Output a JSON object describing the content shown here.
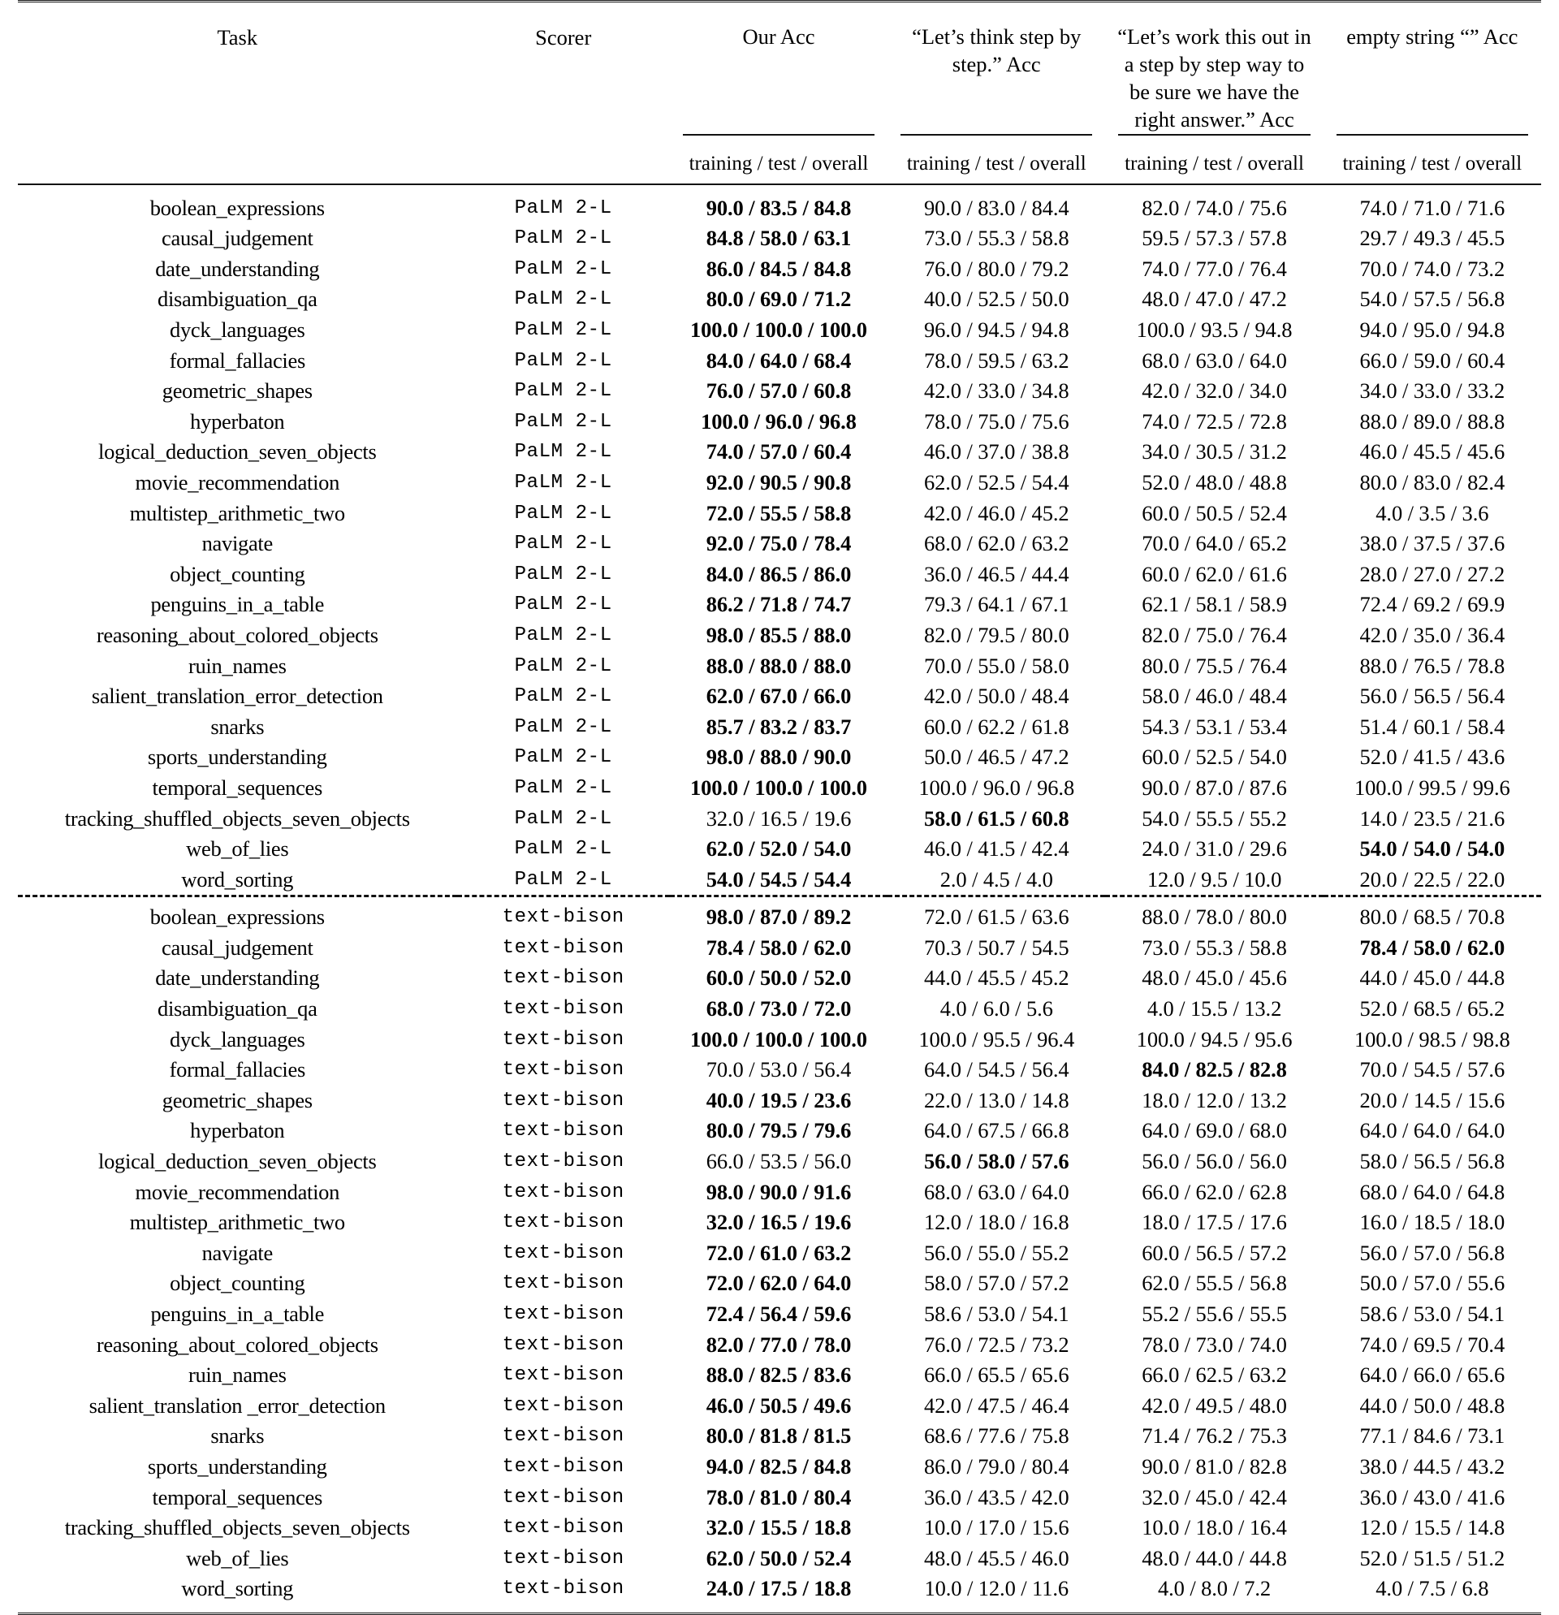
{
  "table": {
    "columns": [
      {
        "key": "task",
        "label": "Task"
      },
      {
        "key": "scorer",
        "label": "Scorer"
      },
      {
        "key": "ours",
        "label": "Our Acc"
      },
      {
        "key": "lets_think",
        "label": "“Let’s think step by step.” Acc"
      },
      {
        "key": "lets_work",
        "label": "“Let’s work this out in a step by step way to be sure we have the right answer.” Acc"
      },
      {
        "key": "empty",
        "label": "empty string “” Acc"
      }
    ],
    "header_lines": {
      "task": [
        "Task"
      ],
      "scorer": [
        "Scorer"
      ],
      "ours": [
        "Our Acc"
      ],
      "lets_think": [
        "“Let’s think step by",
        "step.” Acc"
      ],
      "lets_work": [
        "“Let’s work this out in",
        "a step by step way to",
        "be sure we have the",
        "right answer.” Acc"
      ],
      "empty": [
        "empty string “” Acc"
      ]
    },
    "subheader": "training / test / overall",
    "scorers": {
      "palm": "PaLM 2-L",
      "bison": "text-bison"
    },
    "blocks": [
      {
        "scorer": "PaLM 2-L",
        "rows": [
          {
            "task": "boolean_expressions",
            "ours": "90.0 / 83.5 / 84.8",
            "ours_bold": true,
            "lets_think": "90.0 / 83.0 / 84.4",
            "lets_think_bold": false,
            "lets_work": "82.0 / 74.0 / 75.6",
            "lets_work_bold": false,
            "empty": "74.0 / 71.0 / 71.6",
            "empty_bold": false
          },
          {
            "task": "causal_judgement",
            "ours": "84.8 / 58.0 / 63.1",
            "ours_bold": true,
            "lets_think": "73.0 / 55.3 / 58.8",
            "lets_think_bold": false,
            "lets_work": "59.5 / 57.3 / 57.8",
            "lets_work_bold": false,
            "empty": "29.7 / 49.3 / 45.5",
            "empty_bold": false
          },
          {
            "task": "date_understanding",
            "ours": "86.0 / 84.5 / 84.8",
            "ours_bold": true,
            "lets_think": "76.0 / 80.0 / 79.2",
            "lets_think_bold": false,
            "lets_work": "74.0 / 77.0 / 76.4",
            "lets_work_bold": false,
            "empty": "70.0 / 74.0 / 73.2",
            "empty_bold": false
          },
          {
            "task": "disambiguation_qa",
            "ours": "80.0 / 69.0 / 71.2",
            "ours_bold": true,
            "lets_think": "40.0 / 52.5 / 50.0",
            "lets_think_bold": false,
            "lets_work": "48.0 / 47.0 / 47.2",
            "lets_work_bold": false,
            "empty": "54.0 / 57.5 / 56.8",
            "empty_bold": false
          },
          {
            "task": "dyck_languages",
            "ours": "100.0 / 100.0 / 100.0",
            "ours_bold": true,
            "lets_think": "96.0 / 94.5 / 94.8",
            "lets_think_bold": false,
            "lets_work": "100.0 / 93.5 / 94.8",
            "lets_work_bold": false,
            "empty": "94.0 / 95.0 / 94.8",
            "empty_bold": false
          },
          {
            "task": "formal_fallacies",
            "ours": "84.0 / 64.0 / 68.4",
            "ours_bold": true,
            "lets_think": "78.0 / 59.5 / 63.2",
            "lets_think_bold": false,
            "lets_work": "68.0 / 63.0 / 64.0",
            "lets_work_bold": false,
            "empty": "66.0 / 59.0 / 60.4",
            "empty_bold": false
          },
          {
            "task": "geometric_shapes",
            "ours": "76.0 / 57.0 / 60.8",
            "ours_bold": true,
            "lets_think": "42.0 / 33.0 / 34.8",
            "lets_think_bold": false,
            "lets_work": "42.0 / 32.0 / 34.0",
            "lets_work_bold": false,
            "empty": "34.0 / 33.0 / 33.2",
            "empty_bold": false
          },
          {
            "task": "hyperbaton",
            "ours": "100.0 / 96.0 / 96.8",
            "ours_bold": true,
            "lets_think": "78.0 / 75.0 / 75.6",
            "lets_think_bold": false,
            "lets_work": "74.0 / 72.5 / 72.8",
            "lets_work_bold": false,
            "empty": "88.0 / 89.0 / 88.8",
            "empty_bold": false
          },
          {
            "task": "logical_deduction_seven_objects",
            "ours": "74.0 / 57.0 / 60.4",
            "ours_bold": true,
            "lets_think": "46.0 / 37.0 / 38.8",
            "lets_think_bold": false,
            "lets_work": "34.0 / 30.5 / 31.2",
            "lets_work_bold": false,
            "empty": "46.0 / 45.5 / 45.6",
            "empty_bold": false
          },
          {
            "task": "movie_recommendation",
            "ours": "92.0 / 90.5 / 90.8",
            "ours_bold": true,
            "lets_think": "62.0 / 52.5 / 54.4",
            "lets_think_bold": false,
            "lets_work": "52.0 / 48.0 / 48.8",
            "lets_work_bold": false,
            "empty": "80.0 / 83.0 / 82.4",
            "empty_bold": false
          },
          {
            "task": "multistep_arithmetic_two",
            "ours": "72.0 / 55.5 / 58.8",
            "ours_bold": true,
            "lets_think": "42.0 / 46.0 / 45.2",
            "lets_think_bold": false,
            "lets_work": "60.0 / 50.5 / 52.4",
            "lets_work_bold": false,
            "empty": "4.0 / 3.5 / 3.6",
            "empty_bold": false
          },
          {
            "task": "navigate",
            "ours": "92.0 / 75.0 / 78.4",
            "ours_bold": true,
            "lets_think": "68.0 / 62.0 / 63.2",
            "lets_think_bold": false,
            "lets_work": "70.0 / 64.0 / 65.2",
            "lets_work_bold": false,
            "empty": "38.0 / 37.5 / 37.6",
            "empty_bold": false
          },
          {
            "task": "object_counting",
            "ours": "84.0 / 86.5 / 86.0",
            "ours_bold": true,
            "lets_think": "36.0 / 46.5 / 44.4",
            "lets_think_bold": false,
            "lets_work": "60.0 / 62.0 / 61.6",
            "lets_work_bold": false,
            "empty": "28.0 / 27.0 / 27.2",
            "empty_bold": false
          },
          {
            "task": "penguins_in_a_table",
            "ours": "86.2 / 71.8 / 74.7",
            "ours_bold": true,
            "lets_think": "79.3 / 64.1 / 67.1",
            "lets_think_bold": false,
            "lets_work": "62.1 / 58.1 / 58.9",
            "lets_work_bold": false,
            "empty": "72.4 / 69.2 / 69.9",
            "empty_bold": false
          },
          {
            "task": "reasoning_about_colored_objects",
            "ours": "98.0 / 85.5 / 88.0",
            "ours_bold": true,
            "lets_think": "82.0 / 79.5 / 80.0",
            "lets_think_bold": false,
            "lets_work": "82.0 / 75.0 / 76.4",
            "lets_work_bold": false,
            "empty": "42.0 / 35.0 / 36.4",
            "empty_bold": false
          },
          {
            "task": "ruin_names",
            "ours": "88.0 / 88.0 / 88.0",
            "ours_bold": true,
            "lets_think": "70.0 / 55.0 / 58.0",
            "lets_think_bold": false,
            "lets_work": "80.0 / 75.5 / 76.4",
            "lets_work_bold": false,
            "empty": "88.0 / 76.5 / 78.8",
            "empty_bold": false
          },
          {
            "task": "salient_translation_error_detection",
            "ours": "62.0 / 67.0 / 66.0",
            "ours_bold": true,
            "lets_think": "42.0 / 50.0 / 48.4",
            "lets_think_bold": false,
            "lets_work": "58.0 / 46.0 / 48.4",
            "lets_work_bold": false,
            "empty": "56.0 / 56.5 / 56.4",
            "empty_bold": false
          },
          {
            "task": "snarks",
            "ours": "85.7 / 83.2 / 83.7",
            "ours_bold": true,
            "lets_think": "60.0 / 62.2 / 61.8",
            "lets_think_bold": false,
            "lets_work": "54.3 / 53.1 / 53.4",
            "lets_work_bold": false,
            "empty": "51.4 / 60.1 / 58.4",
            "empty_bold": false
          },
          {
            "task": "sports_understanding",
            "ours": "98.0 / 88.0 / 90.0",
            "ours_bold": true,
            "lets_think": "50.0 / 46.5 / 47.2",
            "lets_think_bold": false,
            "lets_work": "60.0 / 52.5 / 54.0",
            "lets_work_bold": false,
            "empty": "52.0 / 41.5 / 43.6",
            "empty_bold": false
          },
          {
            "task": "temporal_sequences",
            "ours": "100.0 / 100.0 / 100.0",
            "ours_bold": true,
            "lets_think": "100.0 / 96.0 / 96.8",
            "lets_think_bold": false,
            "lets_work": "90.0 / 87.0 / 87.6",
            "lets_work_bold": false,
            "empty": "100.0 / 99.5 / 99.6",
            "empty_bold": false
          },
          {
            "task": "tracking_shuffled_objects_seven_objects",
            "ours": "32.0 / 16.5 / 19.6",
            "ours_bold": false,
            "lets_think": "58.0 / 61.5 / 60.8",
            "lets_think_bold": true,
            "lets_work": "54.0 / 55.5 / 55.2",
            "lets_work_bold": false,
            "empty": "14.0 / 23.5 / 21.6",
            "empty_bold": false
          },
          {
            "task": "web_of_lies",
            "ours": "62.0 / 52.0 / 54.0",
            "ours_bold": true,
            "lets_think": "46.0 / 41.5 / 42.4",
            "lets_think_bold": false,
            "lets_work": "24.0 / 31.0 / 29.6",
            "lets_work_bold": false,
            "empty": "54.0 / 54.0 / 54.0",
            "empty_bold": true
          },
          {
            "task": "word_sorting",
            "ours": "54.0 / 54.5 / 54.4",
            "ours_bold": true,
            "lets_think": "2.0 / 4.5 / 4.0",
            "lets_think_bold": false,
            "lets_work": "12.0 / 9.5 / 10.0",
            "lets_work_bold": false,
            "empty": "20.0 / 22.5 / 22.0",
            "empty_bold": false
          }
        ]
      },
      {
        "scorer": "text-bison",
        "rows": [
          {
            "task": "boolean_expressions",
            "ours": "98.0 / 87.0 / 89.2",
            "ours_bold": true,
            "lets_think": "72.0 / 61.5 / 63.6",
            "lets_think_bold": false,
            "lets_work": "88.0 / 78.0 / 80.0",
            "lets_work_bold": false,
            "empty": "80.0 / 68.5 / 70.8",
            "empty_bold": false
          },
          {
            "task": "causal_judgement",
            "ours": "78.4 / 58.0 / 62.0",
            "ours_bold": true,
            "lets_think": "70.3 / 50.7 / 54.5",
            "lets_think_bold": false,
            "lets_work": "73.0 / 55.3 / 58.8",
            "lets_work_bold": false,
            "empty": "78.4 / 58.0 / 62.0",
            "empty_bold": true
          },
          {
            "task": "date_understanding",
            "ours": "60.0 / 50.0 / 52.0",
            "ours_bold": true,
            "lets_think": "44.0 / 45.5 / 45.2",
            "lets_think_bold": false,
            "lets_work": "48.0 / 45.0 / 45.6",
            "lets_work_bold": false,
            "empty": "44.0 / 45.0 / 44.8",
            "empty_bold": false
          },
          {
            "task": "disambiguation_qa",
            "ours": "68.0 / 73.0 / 72.0",
            "ours_bold": true,
            "lets_think": "4.0 / 6.0 / 5.6",
            "lets_think_bold": false,
            "lets_work": "4.0 / 15.5 / 13.2",
            "lets_work_bold": false,
            "empty": "52.0 / 68.5 / 65.2",
            "empty_bold": false
          },
          {
            "task": "dyck_languages",
            "ours": "100.0 / 100.0 / 100.0",
            "ours_bold": true,
            "lets_think": "100.0 / 95.5 / 96.4",
            "lets_think_bold": false,
            "lets_work": "100.0 / 94.5 / 95.6",
            "lets_work_bold": false,
            "empty": "100.0 / 98.5 / 98.8",
            "empty_bold": false
          },
          {
            "task": "formal_fallacies",
            "ours": "70.0 / 53.0 / 56.4",
            "ours_bold": false,
            "lets_think": "64.0 / 54.5 / 56.4",
            "lets_think_bold": false,
            "lets_work": "84.0 / 82.5 / 82.8",
            "lets_work_bold": true,
            "empty": "70.0 / 54.5 / 57.6",
            "empty_bold": false
          },
          {
            "task": "geometric_shapes",
            "ours": "40.0 / 19.5 / 23.6",
            "ours_bold": true,
            "lets_think": "22.0 / 13.0 / 14.8",
            "lets_think_bold": false,
            "lets_work": "18.0 / 12.0 / 13.2",
            "lets_work_bold": false,
            "empty": "20.0 / 14.5 / 15.6",
            "empty_bold": false
          },
          {
            "task": "hyperbaton",
            "ours": "80.0 / 79.5 / 79.6",
            "ours_bold": true,
            "lets_think": "64.0 / 67.5 / 66.8",
            "lets_think_bold": false,
            "lets_work": "64.0 / 69.0 / 68.0",
            "lets_work_bold": false,
            "empty": "64.0 / 64.0 / 64.0",
            "empty_bold": false
          },
          {
            "task": "logical_deduction_seven_objects",
            "ours": "66.0 / 53.5 / 56.0",
            "ours_bold": false,
            "lets_think": "56.0 / 58.0 / 57.6",
            "lets_think_bold": true,
            "lets_work": "56.0 / 56.0 / 56.0",
            "lets_work_bold": false,
            "empty": "58.0 / 56.5 / 56.8",
            "empty_bold": false
          },
          {
            "task": "movie_recommendation",
            "ours": "98.0 / 90.0 / 91.6",
            "ours_bold": true,
            "lets_think": "68.0 / 63.0 / 64.0",
            "lets_think_bold": false,
            "lets_work": "66.0 / 62.0 / 62.8",
            "lets_work_bold": false,
            "empty": "68.0 / 64.0 / 64.8",
            "empty_bold": false
          },
          {
            "task": "multistep_arithmetic_two",
            "ours": "32.0 / 16.5 / 19.6",
            "ours_bold": true,
            "lets_think": "12.0 / 18.0 / 16.8",
            "lets_think_bold": false,
            "lets_work": "18.0 / 17.5 / 17.6",
            "lets_work_bold": false,
            "empty": "16.0 / 18.5 / 18.0",
            "empty_bold": false
          },
          {
            "task": "navigate",
            "ours": "72.0 / 61.0 / 63.2",
            "ours_bold": true,
            "lets_think": "56.0 / 55.0 / 55.2",
            "lets_think_bold": false,
            "lets_work": "60.0 / 56.5 / 57.2",
            "lets_work_bold": false,
            "empty": "56.0 / 57.0 / 56.8",
            "empty_bold": false
          },
          {
            "task": "object_counting",
            "ours": "72.0 / 62.0 / 64.0",
            "ours_bold": true,
            "lets_think": "58.0 / 57.0 / 57.2",
            "lets_think_bold": false,
            "lets_work": "62.0 / 55.5 / 56.8",
            "lets_work_bold": false,
            "empty": "50.0 / 57.0 / 55.6",
            "empty_bold": false
          },
          {
            "task": "penguins_in_a_table",
            "ours": "72.4 / 56.4 / 59.6",
            "ours_bold": true,
            "lets_think": "58.6 / 53.0 / 54.1",
            "lets_think_bold": false,
            "lets_work": "55.2 / 55.6 / 55.5",
            "lets_work_bold": false,
            "empty": "58.6 / 53.0 / 54.1",
            "empty_bold": false
          },
          {
            "task": "reasoning_about_colored_objects",
            "ours": "82.0 / 77.0 / 78.0",
            "ours_bold": true,
            "lets_think": "76.0 / 72.5 / 73.2",
            "lets_think_bold": false,
            "lets_work": "78.0 / 73.0 / 74.0",
            "lets_work_bold": false,
            "empty": "74.0 / 69.5 / 70.4",
            "empty_bold": false
          },
          {
            "task": "ruin_names",
            "ours": "88.0 / 82.5 / 83.6",
            "ours_bold": true,
            "lets_think": "66.0 / 65.5 / 65.6",
            "lets_think_bold": false,
            "lets_work": "66.0 / 62.5 / 63.2",
            "lets_work_bold": false,
            "empty": "64.0 / 66.0 / 65.6",
            "empty_bold": false
          },
          {
            "task": "salient_translation _error_detection",
            "ours": "46.0 / 50.5 / 49.6",
            "ours_bold": true,
            "lets_think": "42.0 / 47.5 / 46.4",
            "lets_think_bold": false,
            "lets_work": "42.0 / 49.5 / 48.0",
            "lets_work_bold": false,
            "empty": "44.0 / 50.0 / 48.8",
            "empty_bold": false
          },
          {
            "task": "snarks",
            "ours": "80.0 / 81.8 / 81.5",
            "ours_bold": true,
            "lets_think": "68.6 / 77.6 / 75.8",
            "lets_think_bold": false,
            "lets_work": "71.4 / 76.2 / 75.3",
            "lets_work_bold": false,
            "empty": "77.1 / 84.6 / 73.1",
            "empty_bold": false
          },
          {
            "task": "sports_understanding",
            "ours": "94.0 / 82.5 / 84.8",
            "ours_bold": true,
            "lets_think": "86.0 / 79.0 / 80.4",
            "lets_think_bold": false,
            "lets_work": "90.0 / 81.0 / 82.8",
            "lets_work_bold": false,
            "empty": "38.0 / 44.5 / 43.2",
            "empty_bold": false
          },
          {
            "task": "temporal_sequences",
            "ours": "78.0 / 81.0 / 80.4",
            "ours_bold": true,
            "lets_think": "36.0 / 43.5 / 42.0",
            "lets_think_bold": false,
            "lets_work": "32.0 / 45.0 / 42.4",
            "lets_work_bold": false,
            "empty": "36.0 / 43.0 / 41.6",
            "empty_bold": false
          },
          {
            "task": "tracking_shuffled_objects_seven_objects",
            "ours": "32.0 / 15.5 / 18.8",
            "ours_bold": true,
            "lets_think": "10.0 / 17.0 / 15.6",
            "lets_think_bold": false,
            "lets_work": "10.0 / 18.0 / 16.4",
            "lets_work_bold": false,
            "empty": "12.0 / 15.5 / 14.8",
            "empty_bold": false
          },
          {
            "task": "web_of_lies",
            "ours": "62.0 / 50.0 / 52.4",
            "ours_bold": true,
            "lets_think": "48.0 / 45.5 / 46.0",
            "lets_think_bold": false,
            "lets_work": "48.0 / 44.0 / 44.8",
            "lets_work_bold": false,
            "empty": "52.0 / 51.5 / 51.2",
            "empty_bold": false
          },
          {
            "task": "word_sorting",
            "ours": "24.0 / 17.5 / 18.8",
            "ours_bold": true,
            "lets_think": "10.0 / 12.0 / 11.6",
            "lets_think_bold": false,
            "lets_work": "4.0 / 8.0 / 7.2",
            "lets_work_bold": false,
            "empty": "4.0 / 7.5 / 6.8",
            "empty_bold": false
          }
        ]
      }
    ]
  }
}
